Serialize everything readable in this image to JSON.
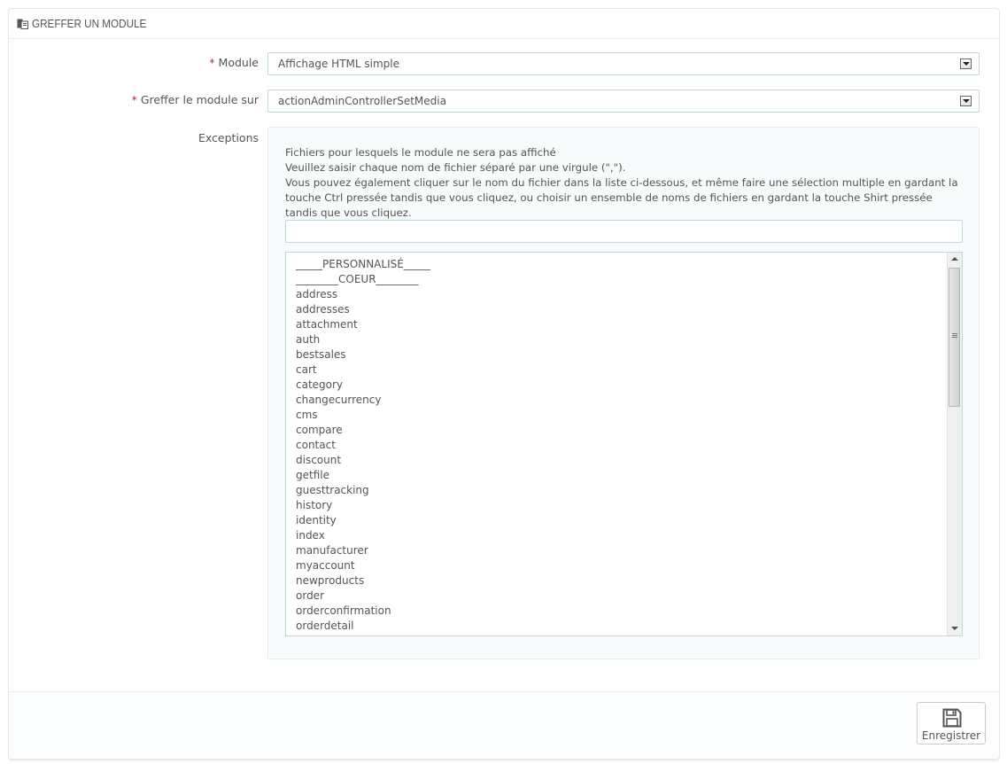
{
  "header": {
    "title": "GREFFER UN MODULE",
    "icon": "plug-module-icon"
  },
  "form": {
    "module": {
      "label": "Module",
      "required_marker": "*",
      "value": "Affichage HTML simple"
    },
    "hook": {
      "label": "Greffer le module sur",
      "required_marker": "*",
      "value": "actionAdminControllerSetMedia"
    },
    "exceptions": {
      "label": "Exceptions",
      "help_lines": [
        "Fichiers pour lesquels le module ne sera pas affiché",
        "Veuillez saisir chaque nom de fichier séparé par une virgule (\",\").",
        "Vous pouvez également cliquer sur le nom du fichier dans la liste ci-dessous, et même faire une sélection multiple en gardant la touche Ctrl pressée tandis que vous cliquez, ou choisir un ensemble de noms de fichiers en gardant la touche Shirt pressée tandis que vous cliquez."
      ],
      "input_value": "",
      "list_items": [
        "_____PERSONNALISÉ_____",
        "________COEUR________",
        "address",
        "addresses",
        "attachment",
        "auth",
        "bestsales",
        "cart",
        "category",
        "changecurrency",
        "cms",
        "compare",
        "contact",
        "discount",
        "getfile",
        "guesttracking",
        "history",
        "identity",
        "index",
        "manufacturer",
        "myaccount",
        "newproducts",
        "order",
        "orderconfirmation",
        "orderdetail"
      ]
    }
  },
  "footer": {
    "save_label": "Enregistrer",
    "save_icon": "floppy-disk-icon"
  },
  "colors": {
    "required": "#e3191b",
    "border": "#c7d6db",
    "well_background": "#f8fbfc"
  }
}
